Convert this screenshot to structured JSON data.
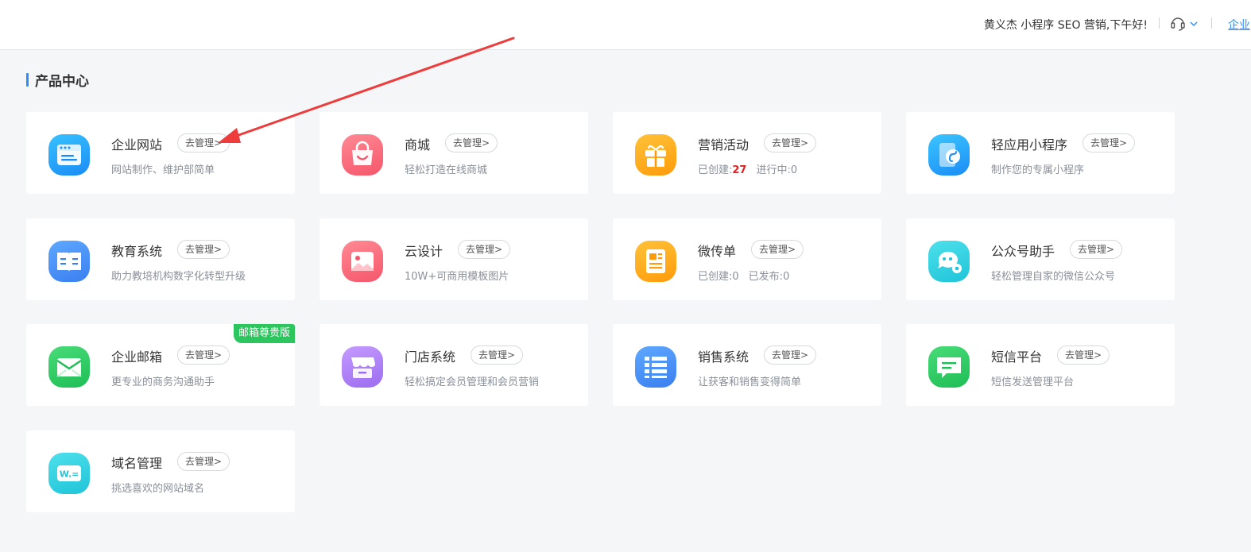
{
  "header": {
    "greeting": "黄义杰  小程序  SEO  营销,下午好!",
    "support_icon": "headset-icon",
    "corp_link": "企业"
  },
  "section": {
    "title": "产品中心"
  },
  "manage_label": "去管理>",
  "products": [
    {
      "name": "企业网站",
      "desc": "网站制作、维护部简单",
      "icon": "website-icon",
      "color_from": "#38c2ff",
      "color_to": "#1a8cf5"
    },
    {
      "name": "商城",
      "desc": "轻松打造在线商城",
      "icon": "shopping-bag-icon",
      "color_from": "#ff8a94",
      "color_to": "#f5566b"
    },
    {
      "name": "营销活动",
      "icon": "gift-icon",
      "color_from": "#ffc23a",
      "color_to": "#ff9b0a",
      "stats": {
        "created_label": "已创建:",
        "created_value": "27",
        "running_label": "进行中:",
        "running_value": "0"
      }
    },
    {
      "name": "轻应用小程序",
      "desc": "制作您的专属小程序",
      "icon": "mini-program-icon",
      "color_from": "#3cc6ff",
      "color_to": "#1a8cf5"
    },
    {
      "name": "教育系统",
      "desc": "助力教培机构数字化转型升级",
      "icon": "book-icon",
      "color_from": "#5ea8ff",
      "color_to": "#3a7ff0"
    },
    {
      "name": "云设计",
      "desc": "10W+可商用模板图片",
      "icon": "image-icon",
      "color_from": "#ff8a94",
      "color_to": "#f5566b"
    },
    {
      "name": "微传单",
      "icon": "flyer-icon",
      "color_from": "#ffc23a",
      "color_to": "#ff9b0a",
      "stats": {
        "created_label": "已创建:",
        "created_value": "0",
        "running_label": "已发布:",
        "running_value": "0"
      }
    },
    {
      "name": "公众号助手",
      "desc": "轻松管理自家的微信公众号",
      "icon": "wechat-icon",
      "color_from": "#4ee0ec",
      "color_to": "#1fc4d8"
    },
    {
      "name": "企业邮箱",
      "desc": "更专业的商务沟通助手",
      "icon": "mail-icon",
      "color_from": "#48dc78",
      "color_to": "#1fbd55",
      "badge": "邮箱尊贵版"
    },
    {
      "name": "门店系统",
      "desc": "轻松搞定会员管理和会员营销",
      "icon": "store-icon",
      "color_from": "#c59bff",
      "color_to": "#9b6cf0"
    },
    {
      "name": "销售系统",
      "desc": "让获客和销售变得简单",
      "icon": "list-icon",
      "color_from": "#5ea8ff",
      "color_to": "#3a7ff0"
    },
    {
      "name": "短信平台",
      "desc": "短信发送管理平台",
      "icon": "message-icon",
      "color_from": "#48dc78",
      "color_to": "#1fbd55"
    },
    {
      "name": "域名管理",
      "desc": "挑选喜欢的网站域名",
      "icon": "domain-icon",
      "color_from": "#4ee0ec",
      "color_to": "#1fc4d8",
      "icon_text": "W.="
    }
  ],
  "annotation_color": "#ee3b3b"
}
